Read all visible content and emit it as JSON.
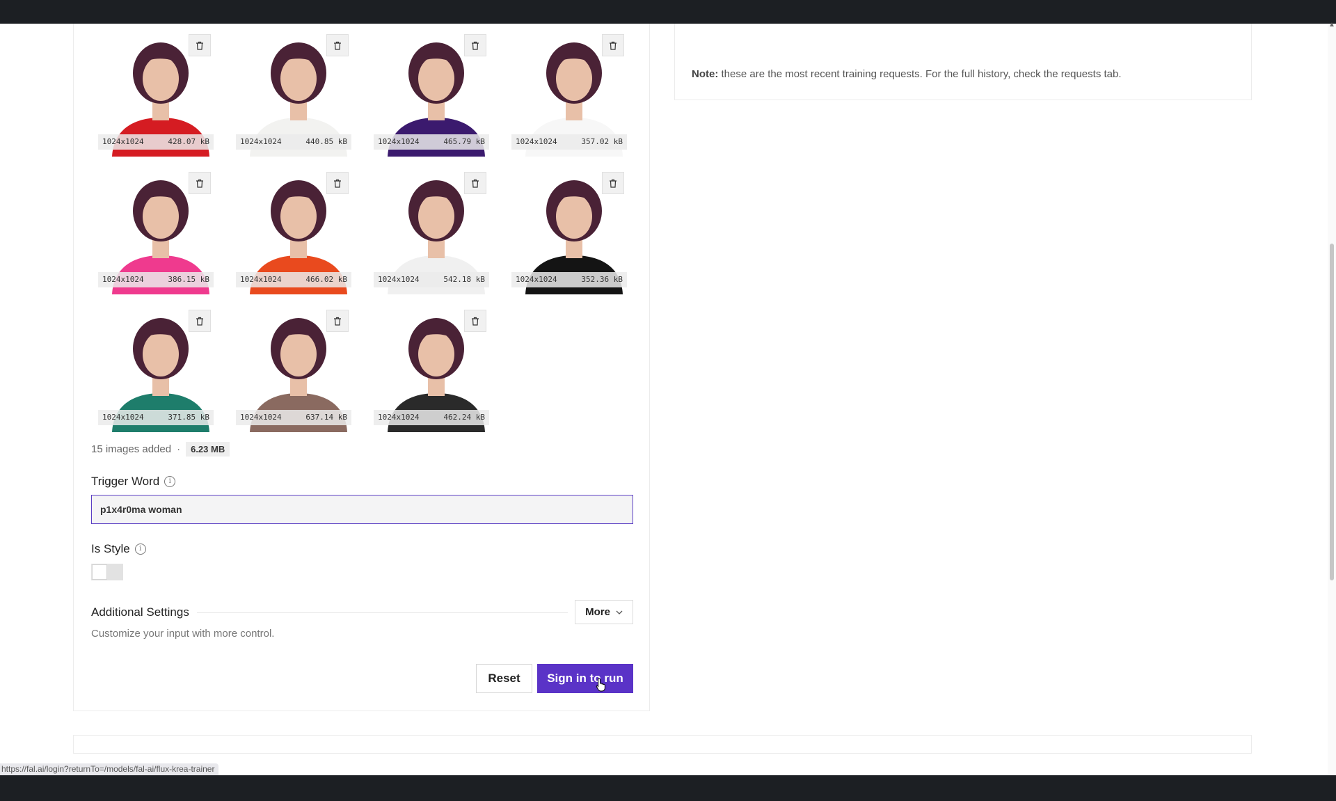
{
  "uploaded_images": {
    "items": [
      {
        "dimensions": "1024x1024",
        "size": "428.07 kB",
        "top_color": "#d51c22"
      },
      {
        "dimensions": "1024x1024",
        "size": "440.85 kB",
        "top_color": "#f2f2f0"
      },
      {
        "dimensions": "1024x1024",
        "size": "465.79 kB",
        "top_color": "#3b1a6e"
      },
      {
        "dimensions": "1024x1024",
        "size": "357.02 kB",
        "top_color": "#f7f7f7"
      },
      {
        "dimensions": "1024x1024",
        "size": "386.15 kB",
        "top_color": "#ef3a8e"
      },
      {
        "dimensions": "1024x1024",
        "size": "466.02 kB",
        "top_color": "#e94a1e"
      },
      {
        "dimensions": "1024x1024",
        "size": "542.18 kB",
        "top_color": "#f0f0f0"
      },
      {
        "dimensions": "1024x1024",
        "size": "352.36 kB",
        "top_color": "#141414"
      },
      {
        "dimensions": "1024x1024",
        "size": "371.85 kB",
        "top_color": "#1e7d6b"
      },
      {
        "dimensions": "1024x1024",
        "size": "637.14 kB",
        "top_color": "#8a6a60"
      },
      {
        "dimensions": "1024x1024",
        "size": "462.24 kB",
        "top_color": "#2a2a2a"
      }
    ],
    "hair_color": "#4a2236",
    "skin_color": "#e8c0a8"
  },
  "summary": {
    "count_text": "15 images added",
    "separator": "·",
    "total_size": "6.23 MB"
  },
  "trigger_word": {
    "label": "Trigger Word",
    "value": "p1x4r0ma woman",
    "info_icon": "i"
  },
  "is_style": {
    "label": "Is Style",
    "info_icon": "i",
    "enabled": false
  },
  "additional_settings": {
    "title": "Additional Settings",
    "more_label": "More",
    "description": "Customize your input with more control."
  },
  "actions": {
    "reset_label": "Reset",
    "run_label": "Sign in to run"
  },
  "requests_panel": {
    "note_label": "Note:",
    "note_text": " these are the most recent training requests. For the full history, check the requests tab."
  },
  "status_bar": {
    "url": "https://fal.ai/login?returnTo=/models/fal-ai/flux-krea-trainer"
  },
  "colors": {
    "accent": "#5a33c7",
    "input_border": "#5b3fc4",
    "chrome_dark": "#1c1f23"
  }
}
